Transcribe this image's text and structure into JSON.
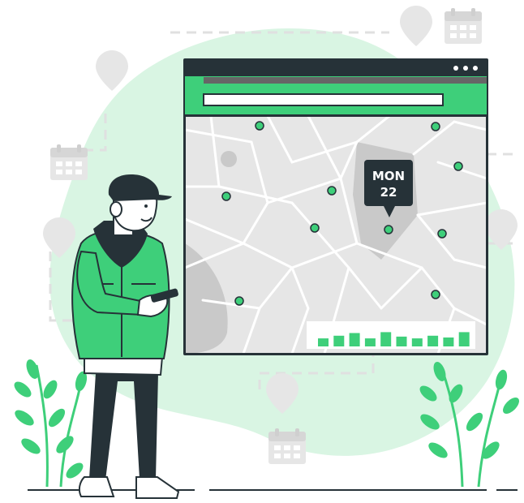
{
  "date_tag": {
    "day": "MON",
    "date": "22"
  },
  "browser": {
    "window_dots": 3,
    "address_bar_value": ""
  },
  "map": {
    "marker_count": 10
  },
  "bar_widget": {
    "levels": [
      0.45,
      0.6,
      0.75,
      0.45,
      0.8,
      0.55,
      0.45,
      0.6,
      0.5,
      0.8
    ]
  },
  "colors": {
    "accent": "#3ecf7a",
    "dark": "#263238",
    "blob": "#d9f5e3",
    "map_bg": "#e6e6e6",
    "road": "#ffffff",
    "faded_icon": "#ebebeb"
  },
  "icons": [
    "calendar-icon",
    "location-pin-icon",
    "smartphone-icon",
    "plant-icon"
  ]
}
